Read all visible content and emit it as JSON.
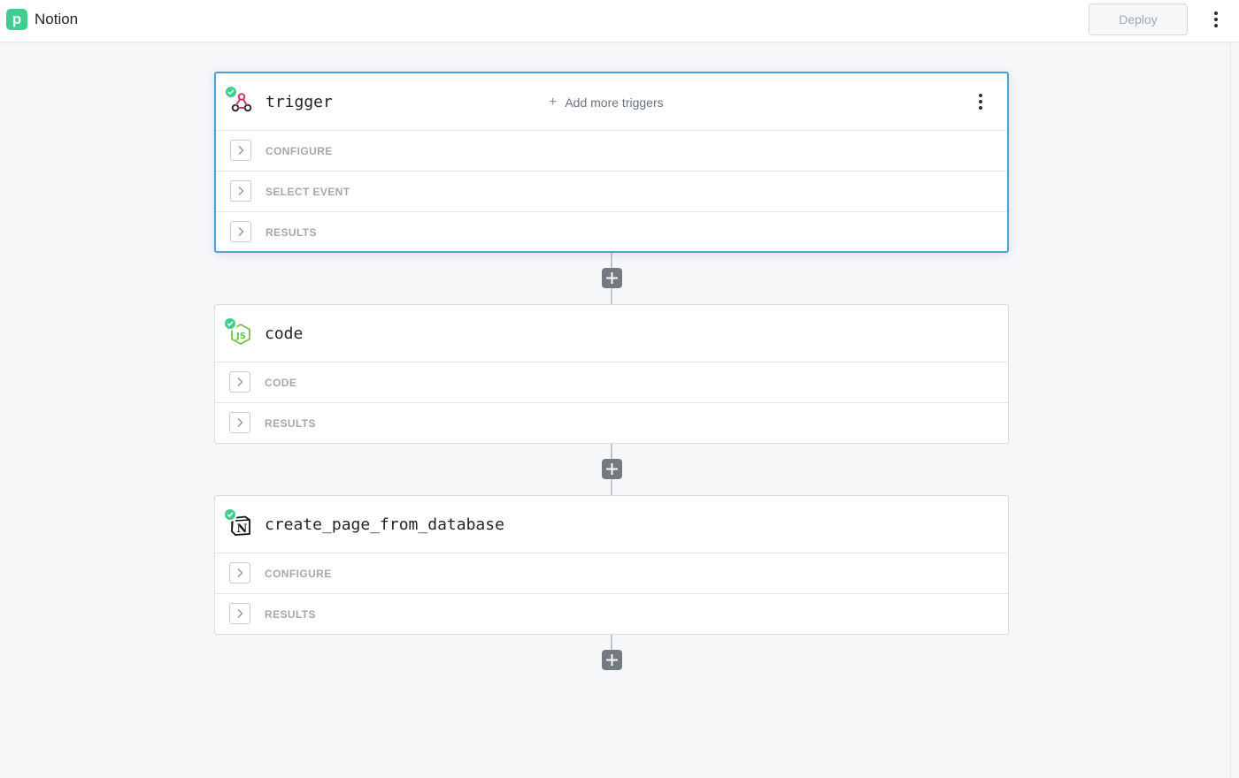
{
  "header": {
    "app_title": "Notion",
    "deploy_label": "Deploy",
    "logo_letter": "p"
  },
  "steps": [
    {
      "name": "trigger",
      "icon": "webhook-icon",
      "status": "success",
      "add_triggers_label": "Add more triggers",
      "sections": [
        "CONFIGURE",
        "SELECT EVENT",
        "RESULTS"
      ]
    },
    {
      "name": "code",
      "icon": "nodejs-icon",
      "status": "success",
      "sections": [
        "CODE",
        "RESULTS"
      ]
    },
    {
      "name": "create_page_from_database",
      "icon": "notion-icon",
      "status": "success",
      "sections": [
        "CONFIGURE",
        "RESULTS"
      ]
    }
  ],
  "colors": {
    "accent_selected": "#4aa3d8",
    "success": "#3ecf8e",
    "add_button": "#767b82"
  }
}
